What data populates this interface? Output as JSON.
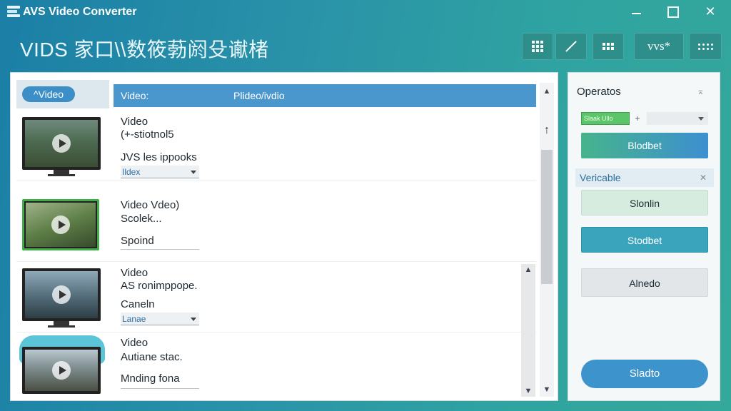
{
  "window": {
    "title": "AVS Video Converter",
    "close_glyph": "✕"
  },
  "header": {
    "brand": "VIDS 家口\\\\数筱葧阏殳谳楮",
    "toolbar": [
      {
        "icon": "grid-icon"
      },
      {
        "icon": "pen-icon"
      },
      {
        "icon": "grid-small-icon"
      },
      {
        "label": "vvs*"
      },
      {
        "icon": "dots-grid-icon"
      }
    ]
  },
  "list": {
    "tab_label": "^Video",
    "header_col1": "Video:",
    "header_col2": "Plideo/ivdio",
    "scroll_up": "▲",
    "scroll_mid": "↑",
    "scroll_down": "▼",
    "rows": [
      {
        "line1": "Video",
        "line2": "(+-stiotnol5",
        "line3": "JVS les ippooks",
        "select": "Ildex"
      },
      {
        "line1": "Video Vdeo)",
        "line2": "Scolek...",
        "line3": "Spoind",
        "select": ""
      },
      {
        "line1": "Video",
        "line2": "AS ronimppope.",
        "line3": "Caneln",
        "select": "Lanae"
      },
      {
        "line1": "Video",
        "line2": "Autiane stac.",
        "line3": "Mnding fona",
        "select": ""
      }
    ]
  },
  "operations": {
    "title": "Operatos",
    "pin_glyph": "⌅",
    "mini_label": "Slaak Ullo",
    "mini_plus": "+",
    "btn1": "Blodbet",
    "section": "Vericable",
    "section_close": "✕",
    "btn2": "Slonlin",
    "btn3": "Stodbet",
    "btn4": "Alnedo",
    "start": "Sladto"
  },
  "colors": {
    "accent": "#3d93cc",
    "header_bar": "#4a97ce",
    "background_teal": "#2fa3a1"
  }
}
